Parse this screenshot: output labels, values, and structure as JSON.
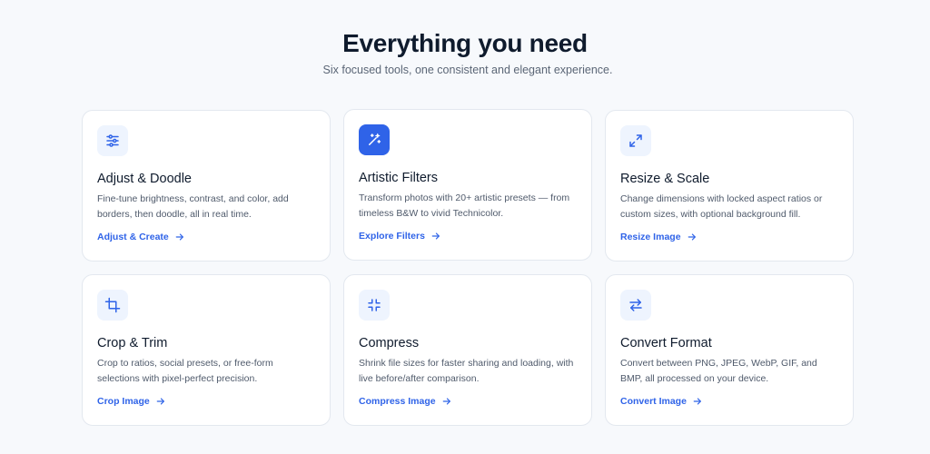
{
  "header": {
    "title": "Everything you need",
    "subtitle": "Six focused tools, one consistent and elegant experience."
  },
  "colors": {
    "accent": "#2f63e8",
    "icon_bg": "#eef4fe",
    "background": "#f7f9fc",
    "card_border": "#e3e8ef"
  },
  "tools": [
    {
      "title": "Adjust & Doodle",
      "description": "Fine-tune brightness, contrast, and color, add borders, then doodle, all in real time.",
      "link": "Adjust & Create",
      "icon": "sliders-icon"
    },
    {
      "title": "Artistic Filters",
      "description": "Transform photos with 20+ artistic presets — from timeless B&W to vivid Technicolor.",
      "link": "Explore Filters",
      "icon": "magic-wand-icon"
    },
    {
      "title": "Resize & Scale",
      "description": "Change dimensions with locked aspect ratios or custom sizes, with optional background fill.",
      "link": "Resize Image",
      "icon": "expand-arrows-icon"
    },
    {
      "title": "Crop & Trim",
      "description": "Crop to ratios, social presets, or free-form selections with pixel-perfect precision.",
      "link": "Crop Image",
      "icon": "crop-icon"
    },
    {
      "title": "Compress",
      "description": "Shrink file sizes for faster sharing and loading, with live before/after comparison.",
      "link": "Compress Image",
      "icon": "compress-arrows-icon"
    },
    {
      "title": "Convert Format",
      "description": "Convert between PNG, JPEG, WebP, GIF, and BMP, all processed on your device.",
      "link": "Convert Image",
      "icon": "swap-arrows-icon"
    }
  ]
}
